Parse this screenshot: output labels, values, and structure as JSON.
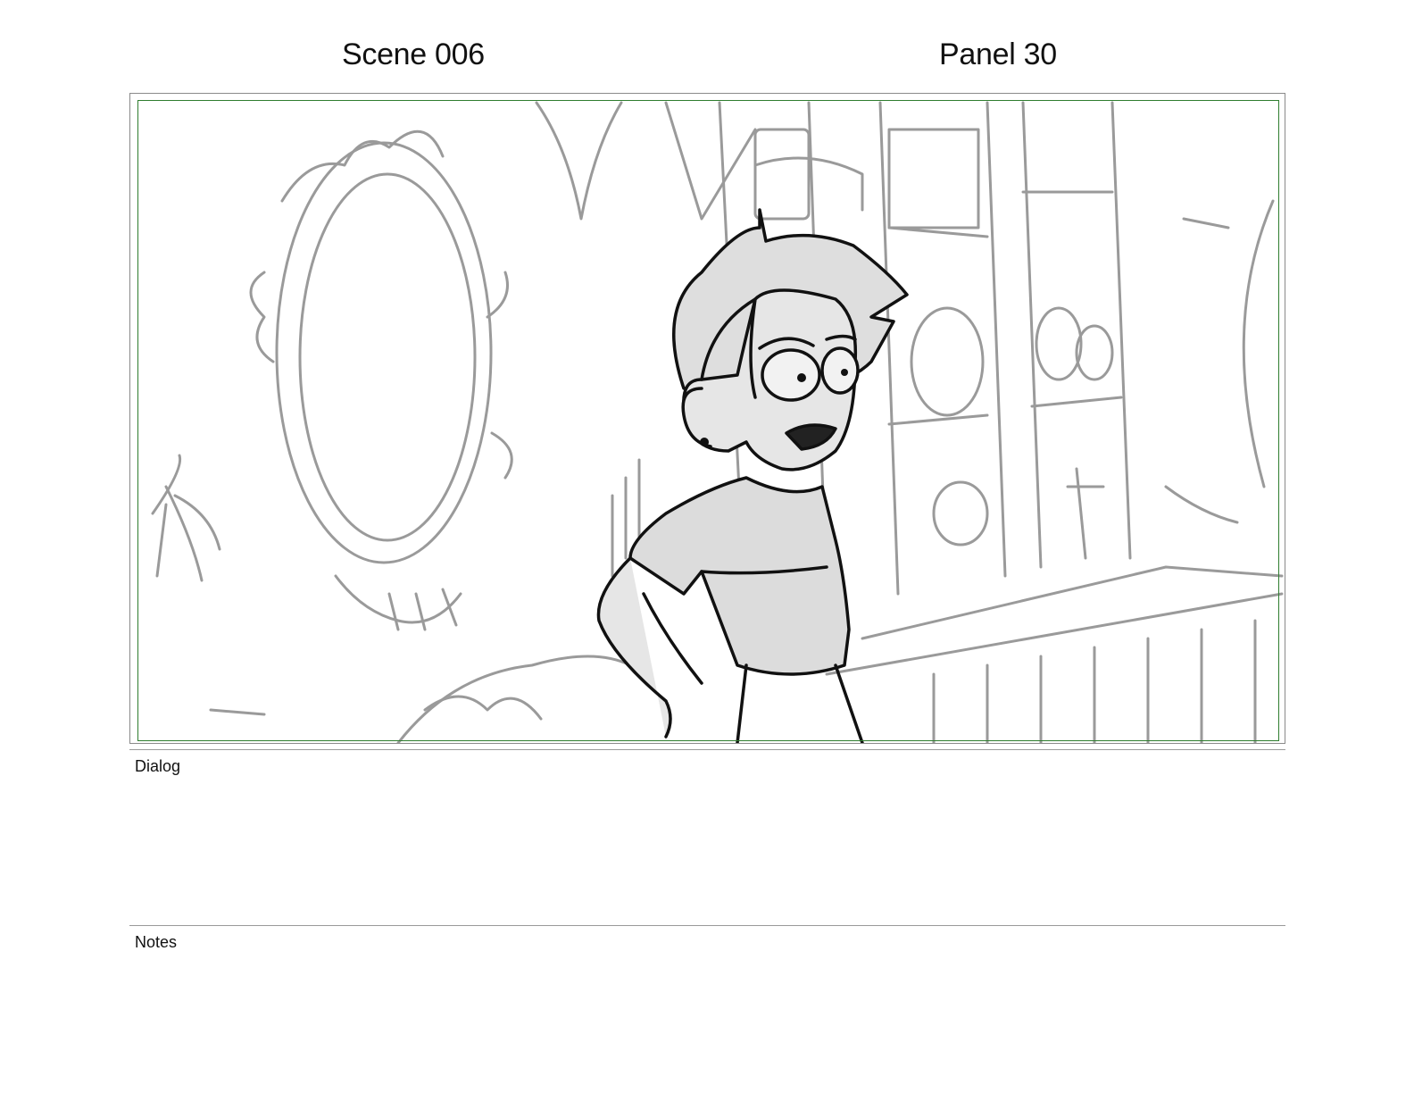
{
  "header": {
    "scene_label": "Scene 006",
    "panel_label": "Panel 30"
  },
  "panel": {
    "frame_color": "#8a8a8a",
    "safe_area_color": "#2f7d2f",
    "illustration": "storyboard-sketch-girl-in-shop"
  },
  "dialog": {
    "label": "Dialog",
    "text": ""
  },
  "notes": {
    "label": "Notes",
    "text": ""
  }
}
